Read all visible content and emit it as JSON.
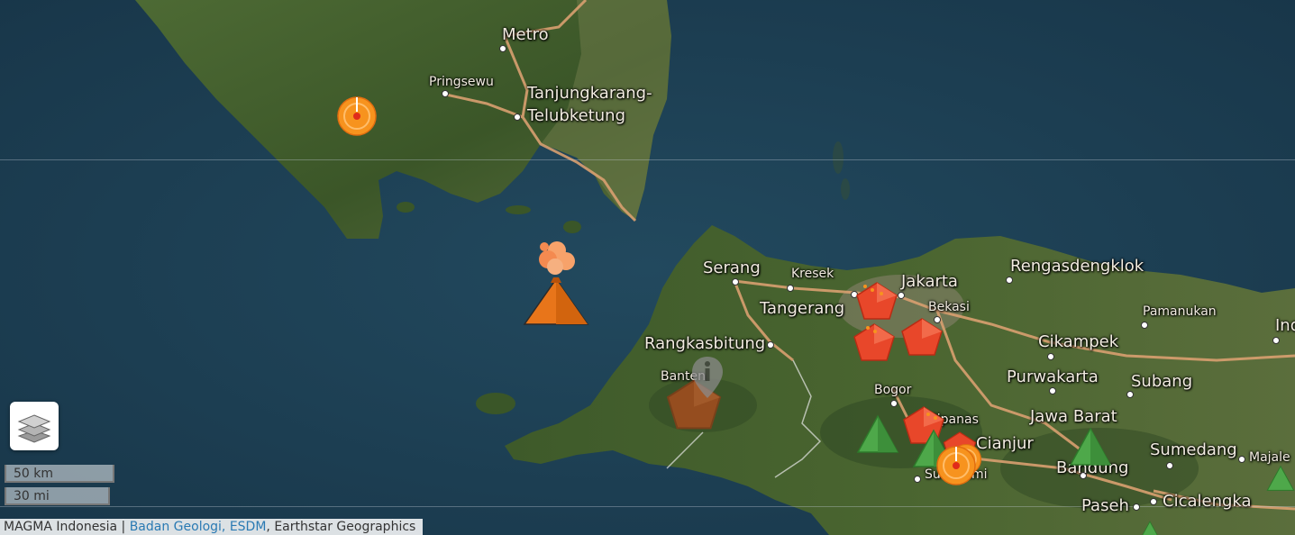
{
  "map": {
    "labels": [
      {
        "id": "metro",
        "text": "Metro",
        "size": "big"
      },
      {
        "id": "pringsewu",
        "text": "Pringsewu",
        "size": "small"
      },
      {
        "id": "tanjungkarang",
        "text": "Tanjungkarang-",
        "size": "big"
      },
      {
        "id": "telubketung",
        "text": "Telubketung",
        "size": "big"
      },
      {
        "id": "serang",
        "text": "Serang",
        "size": "big"
      },
      {
        "id": "kresek",
        "text": "Kresek",
        "size": "small"
      },
      {
        "id": "jakarta",
        "text": "Jakarta",
        "size": "big"
      },
      {
        "id": "tangerang",
        "text": "Tangerang",
        "size": "big"
      },
      {
        "id": "bekasi",
        "text": "Bekasi",
        "size": "small"
      },
      {
        "id": "rengasdengklok",
        "text": "Rengasdengklok",
        "size": "big"
      },
      {
        "id": "pamanukan",
        "text": "Pamanukan",
        "size": "small"
      },
      {
        "id": "rangkasbitung",
        "text": "Rangkasbitung",
        "size": "big"
      },
      {
        "id": "banten",
        "text": "Banten",
        "size": "small"
      },
      {
        "id": "cikampek",
        "text": "Cikampek",
        "size": "big"
      },
      {
        "id": "purwakarta",
        "text": "Purwakarta",
        "size": "big"
      },
      {
        "id": "subang",
        "text": "Subang",
        "size": "big"
      },
      {
        "id": "bogor",
        "text": "Bogor",
        "size": "small"
      },
      {
        "id": "jawabarat",
        "text": "Jawa Barat",
        "size": "big"
      },
      {
        "id": "cipanas",
        "text": "Cipanas",
        "size": "small"
      },
      {
        "id": "cianjur",
        "text": "Cianjur",
        "size": "big"
      },
      {
        "id": "sukabumi",
        "text": "Sukabumi",
        "size": "small"
      },
      {
        "id": "sumedang",
        "text": "Sumedang",
        "size": "big"
      },
      {
        "id": "majalengka",
        "text": "Majale",
        "size": "small"
      },
      {
        "id": "bandung",
        "text": "Bandung",
        "size": "big"
      },
      {
        "id": "paseh",
        "text": "Paseh",
        "size": "big"
      },
      {
        "id": "cicalengka",
        "text": "Cicalengka",
        "size": "big"
      },
      {
        "id": "indramayu",
        "text": "Ind",
        "size": "big"
      }
    ],
    "markers": {
      "erupting_volcano": "erupting-volcano-icon",
      "earthquake": "earthquake-icon",
      "ground_movement": "ground-movement-icon",
      "normal_volcano": "normal-volcano-icon",
      "info_pin": "info-pin-icon"
    },
    "colors": {
      "sea": "#1c3c50",
      "land": "#3f5a2c",
      "road": "#d9a070",
      "earthquake": "#f7931e",
      "ground_movement": "#e8472a",
      "normal_volcano": "#4ea84a"
    }
  },
  "controls": {
    "layers_icon": "layers-icon",
    "scale_km": "50 km",
    "scale_mi": "30 mi"
  },
  "attribution": {
    "prefix": "MAGMA Indonesia | ",
    "link": "Badan Geologi, ESDM",
    "suffix": ", Earthstar Geographics"
  }
}
